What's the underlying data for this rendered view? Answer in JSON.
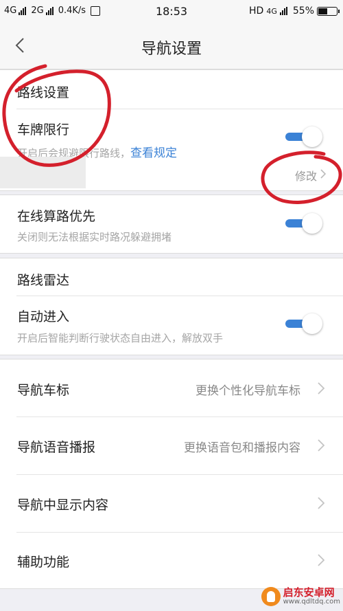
{
  "status_bar": {
    "net1": "4G",
    "net2": "2G",
    "speed": "0.4K/s",
    "time": "18:53",
    "hd": "HD",
    "net3": "4G",
    "battery": "55%",
    "battery_level": 0.55
  },
  "nav": {
    "title": "导航设置"
  },
  "route_settings": {
    "header": "路线设置",
    "plate": {
      "title": "车牌限行",
      "subtitle": "开启后会规避限行路线，",
      "link": "查看规定",
      "enabled": true,
      "modify": "修改"
    }
  },
  "online": {
    "title": "在线算路优先",
    "subtitle": "关闭则无法根据实时路况躲避拥堵",
    "enabled": true
  },
  "radar": {
    "header": "路线雷达",
    "auto": {
      "title": "自动进入",
      "subtitle": "开启后智能判断行驶状态自由进入，解放双手",
      "enabled": true
    }
  },
  "menu": [
    {
      "label": "导航车标",
      "value": "更换个性化导航车标"
    },
    {
      "label": "导航语音播报",
      "value": "更换语音包和播报内容"
    },
    {
      "label": "导航中显示内容",
      "value": ""
    },
    {
      "label": "辅助功能",
      "value": ""
    }
  ],
  "watermark": {
    "name": "启东安卓网",
    "url": "www.qdltdq.com"
  },
  "colors": {
    "accent": "#3b82d6",
    "annotation": "#d4202c"
  }
}
